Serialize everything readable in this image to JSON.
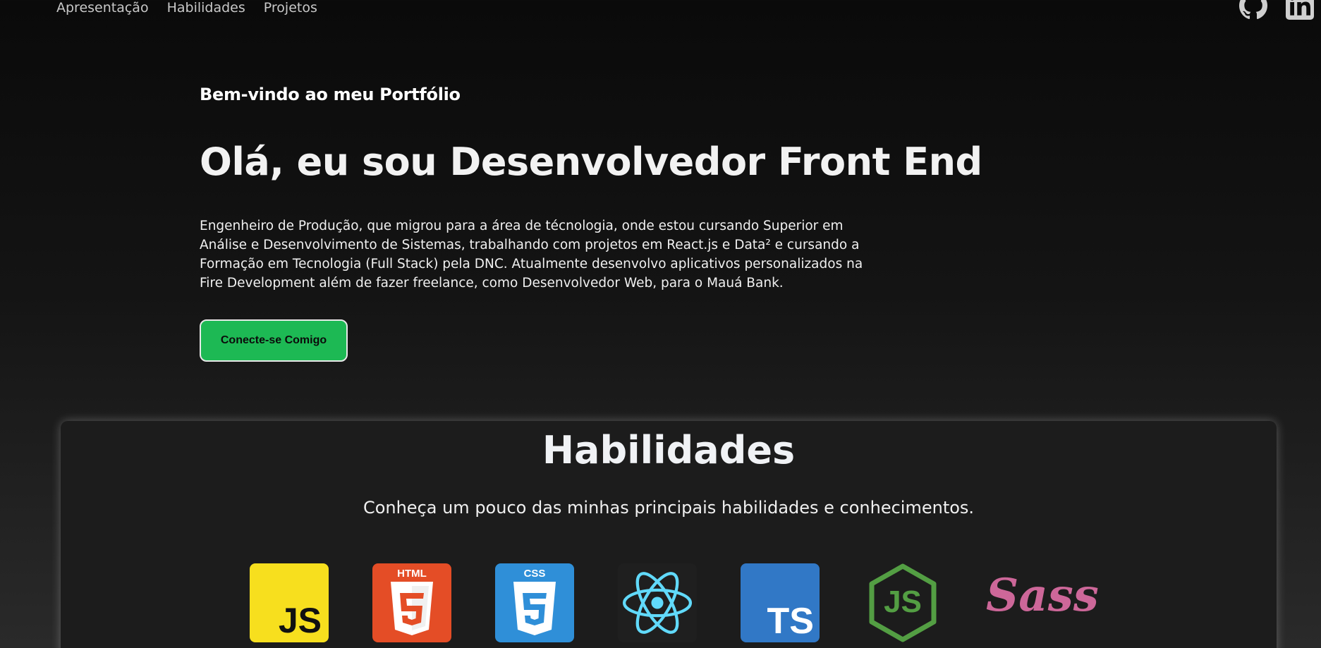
{
  "nav": {
    "items": [
      {
        "label": "Apresentação"
      },
      {
        "label": "Habilidades"
      },
      {
        "label": "Projetos"
      }
    ]
  },
  "social": [
    {
      "icon": "github-icon"
    },
    {
      "icon": "linkedin-icon"
    }
  ],
  "hero": {
    "welcome": "Bem-vindo ao meu Portfólio",
    "headline": "Olá, eu sou Desenvolvedor Front End",
    "bio": "Engenheiro de Produção, que migrou para a área de técnologia, onde estou cursando Superior em Análise e Desenvolvimento de Sistemas, trabalhando com projetos em React.js e Data² e cursando a Formação em Tecnologia (Full Stack) pela DNC. Atualmente desenvolvo aplicativos personalizados na Fire Development além de fazer freelance, como Desenvolvedor Web, para o Mauá Bank.",
    "cta_label": "Conecte-se Comigo"
  },
  "skills": {
    "title": "Habilidades",
    "subtitle": "Conheça um pouco das minhas principais habilidades e conhecimentos.",
    "items": [
      {
        "icon": "javascript-icon",
        "label": "JS",
        "color": "#f7df1e"
      },
      {
        "icon": "html5-icon",
        "label": "HTML",
        "color": "#e44d26"
      },
      {
        "icon": "css3-icon",
        "label": "CSS",
        "color": "#2f8fd8"
      },
      {
        "icon": "react-icon",
        "label": "",
        "color": "#61dafb"
      },
      {
        "icon": "typescript-icon",
        "label": "TS",
        "color": "#3178c6"
      },
      {
        "icon": "nodejs-icon",
        "label": "JS",
        "color": "#539e43"
      },
      {
        "icon": "sass-icon",
        "label": "Sass",
        "color": "#cd6799"
      }
    ]
  },
  "colors": {
    "accent": "#1db954",
    "background": "#0a0a0a",
    "card": "#1c1c1c"
  }
}
